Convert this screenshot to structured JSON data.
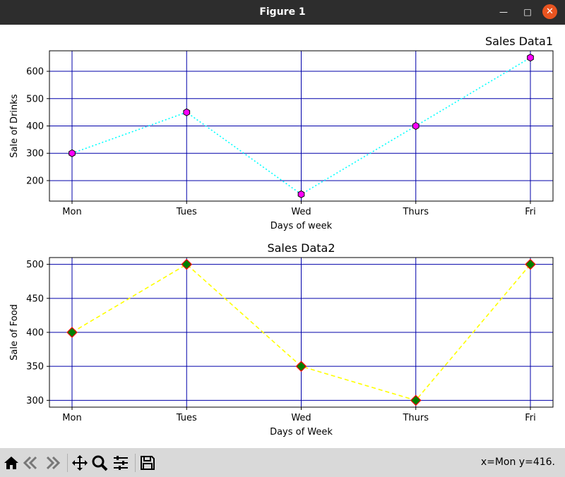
{
  "window": {
    "title": "Figure 1"
  },
  "toolbar": {
    "buttons": [
      "home-icon",
      "back-icon",
      "forward-icon",
      "pan-icon",
      "zoom-icon",
      "configure-subplots-icon",
      "save-icon"
    ],
    "status": "x=Mon y=416."
  },
  "colors": {
    "grid": "#0000aa",
    "line1": "#00ffff",
    "marker1": "#ff00ff",
    "line2": "#ffff00",
    "marker2_fill": "#008000",
    "marker2_edge": "#ff0000"
  },
  "chart_data": [
    {
      "type": "line",
      "title": "Sales Data1",
      "title_align": "right",
      "categories": [
        "Mon",
        "Tues",
        "Wed",
        "Thurs",
        "Fri"
      ],
      "series": [
        {
          "values": [
            300,
            450,
            150,
            400,
            650
          ],
          "line_style": "dotted",
          "marker": "hexagon"
        }
      ],
      "xlabel": "Days of week",
      "ylabel": "Sale of Drinks",
      "yticks": [
        200,
        300,
        400,
        500,
        600
      ],
      "ylim": [
        125,
        675
      ],
      "grid": true
    },
    {
      "type": "line",
      "title": "Sales Data2",
      "title_align": "center",
      "categories": [
        "Mon",
        "Tues",
        "Wed",
        "Thurs",
        "Fri"
      ],
      "series": [
        {
          "values": [
            400,
            500,
            350,
            300,
            500
          ],
          "line_style": "dashed",
          "marker": "diamond"
        }
      ],
      "xlabel": "Days of Week",
      "ylabel": "Sale of Food",
      "yticks": [
        300,
        350,
        400,
        450,
        500
      ],
      "ylim": [
        290,
        510
      ],
      "grid": true
    }
  ]
}
